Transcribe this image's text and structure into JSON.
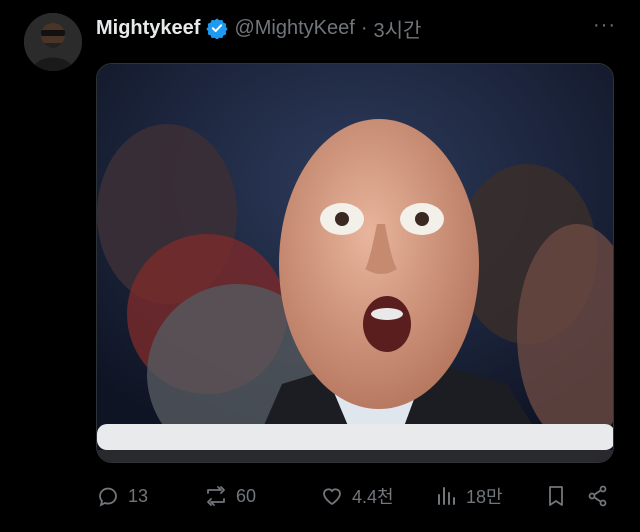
{
  "tweet": {
    "display_name": "Mightykeef",
    "handle": "@MightyKeef",
    "separator": "·",
    "time": "3시간",
    "more": "···",
    "verified_color": "#1d9bf0"
  },
  "media": {
    "description_icon": "photo"
  },
  "actions": {
    "replies": "13",
    "reposts": "60",
    "likes": "4.4천",
    "views": "18만"
  }
}
